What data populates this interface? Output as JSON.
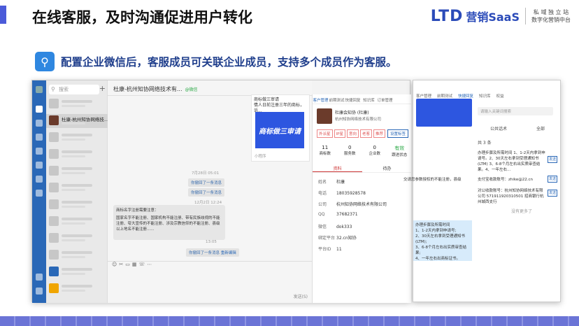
{
  "header": {
    "title": "在线客服，及时沟通促进用户转化",
    "logo_mark": "LTD",
    "logo_brand": "营销SaaS",
    "logo_tag_line1": "私 域 独 立 站",
    "logo_tag_line2": "数字化营销中台"
  },
  "subheading": {
    "text": "配置企业微信后，客服成员可关联企业成员，支持多个成员作为客服。"
  },
  "app": {
    "search_placeholder": "搜索",
    "selected_chat": "杜康-杭州知协网络技...",
    "chat_title": "杜康-杭州知协网络技术有...",
    "chat_tag": "@微信",
    "card_title": "商标做三审请",
    "card_desc": "情人日前注册三年的商标，诉...",
    "card_image_text": "商标做三审请",
    "card_footer": "小程序",
    "time1": "7月28日 05:01",
    "sys1": "你撤回了一条消息",
    "sys2": "你撤回了一条消息",
    "time2": "12月2日 12:24",
    "msg_title": "商标名字注册需要注意：",
    "msg_body": "国家名字不能注册、国家机构不能注册、带有民族歧视的不能注册、夸大宣传的不能注册、涉及宗教信仰的不能注册、县级以上地名不能注册......",
    "time3": "13:05",
    "sys3": "你撤回了一条消息",
    "sys3_link": "重新编辑",
    "send_label": "发送(S)",
    "panel_tabs": [
      "客户管理",
      "前期测试",
      "快捷回复",
      "知识库",
      "订单管理"
    ],
    "customer_name": "杜康会知协 (杜康)",
    "customer_company": "杭州知协网络技术有限公司",
    "tags": [
      "外派星",
      "IP星",
      "意向",
      "老客",
      "推荐"
    ],
    "tag_button": "设置标签",
    "stats": [
      {
        "value": "11",
        "label": "商标数"
      },
      {
        "value": "0",
        "label": "服务数"
      },
      {
        "value": "0",
        "label": "企业数"
      },
      {
        "value": "有效",
        "label": "跟进状态"
      }
    ],
    "profile_tabs": [
      "资料",
      "待办"
    ],
    "fields": [
      {
        "k": "姓名",
        "v": "杜康"
      },
      {
        "k": "电话",
        "v": "18035928578"
      },
      {
        "k": "公司",
        "v": "杭州知协网络技术有限公司"
      },
      {
        "k": "QQ",
        "v": "37682371"
      },
      {
        "k": "微信",
        "v": "dok333"
      },
      {
        "k": "绑定平台",
        "v": "32.cn知协"
      },
      {
        "k": "平台ID",
        "v": "11"
      }
    ]
  },
  "win2": {
    "tabs": [
      "客户管理",
      "前期测试",
      "快捷回复",
      "知识库",
      "权益"
    ],
    "search_placeholder": "请输入关键词搜索",
    "filter_left": "公共话术",
    "filter_right": "全部",
    "count": "共 3 条",
    "items": [
      "办理步骤及所需时间 1、1-2天内拿到申请号。2、30天左右拿到受理通知书(LTM) 3、6-8个月左右出实质审查结果。4、一年左右...",
      "支付宝收款账号：zhike@22.cn",
      "对公收款账号：杭州知协网络技术有限公司 571911920310501 招商银行杭州城西支行"
    ],
    "send": "发送",
    "no_more": "没有更多了",
    "bubble": "办理步骤及所需时间\n1、1-2天内拿到申请号;\n2、30天左右拿到受理通知书(LTM);\n3、6-8个月左右出实质审查结果;\n4、一年左右出商标证书。",
    "snippet": "交请您参数授权的不能注册，县级"
  }
}
